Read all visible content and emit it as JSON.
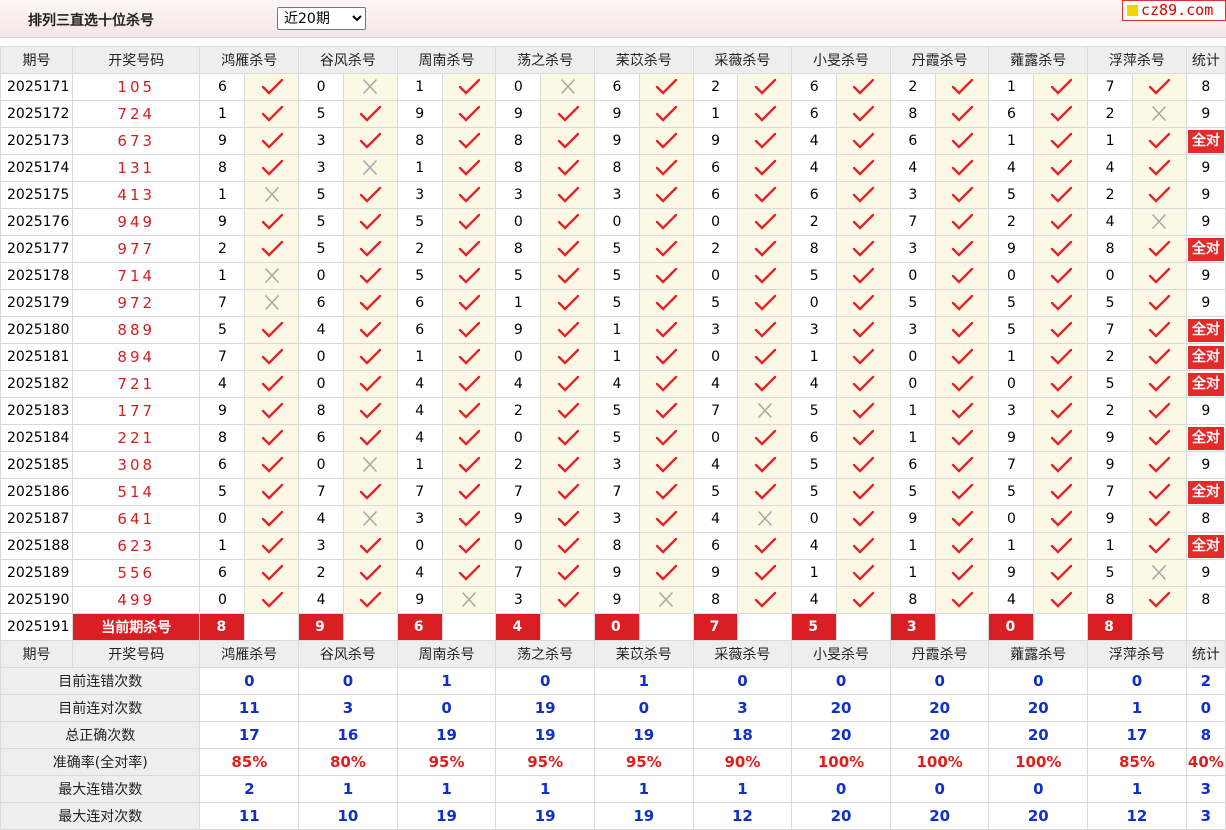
{
  "header": {
    "title": "排列三直选十位杀号",
    "period_select": "近20期"
  },
  "logo": {
    "text": "cz89.com"
  },
  "columns": {
    "issue": "期号",
    "draw": "开奖号码",
    "experts": [
      "鸿雁杀号",
      "谷风杀号",
      "周南杀号",
      "荡之杀号",
      "苿苡杀号",
      "采薇杀号",
      "小旻杀号",
      "丹霞杀号",
      "蕹露杀号",
      "浮萍杀号"
    ],
    "total": "统计"
  },
  "rows": [
    {
      "issue": "2025171",
      "draw": "105",
      "kills": [
        [
          6,
          1
        ],
        [
          0,
          0
        ],
        [
          1,
          1
        ],
        [
          0,
          0
        ],
        [
          6,
          1
        ],
        [
          2,
          1
        ],
        [
          6,
          1
        ],
        [
          2,
          1
        ],
        [
          1,
          1
        ],
        [
          7,
          1
        ]
      ],
      "total": "8"
    },
    {
      "issue": "2025172",
      "draw": "724",
      "kills": [
        [
          1,
          1
        ],
        [
          5,
          1
        ],
        [
          9,
          1
        ],
        [
          9,
          1
        ],
        [
          9,
          1
        ],
        [
          1,
          1
        ],
        [
          6,
          1
        ],
        [
          8,
          1
        ],
        [
          6,
          1
        ],
        [
          2,
          0
        ]
      ],
      "total": "9"
    },
    {
      "issue": "2025173",
      "draw": "673",
      "kills": [
        [
          9,
          1
        ],
        [
          3,
          1
        ],
        [
          8,
          1
        ],
        [
          8,
          1
        ],
        [
          9,
          1
        ],
        [
          9,
          1
        ],
        [
          4,
          1
        ],
        [
          6,
          1
        ],
        [
          1,
          1
        ],
        [
          1,
          1
        ]
      ],
      "total": "全对"
    },
    {
      "issue": "2025174",
      "draw": "131",
      "kills": [
        [
          8,
          1
        ],
        [
          3,
          0
        ],
        [
          1,
          1
        ],
        [
          8,
          1
        ],
        [
          8,
          1
        ],
        [
          6,
          1
        ],
        [
          4,
          1
        ],
        [
          4,
          1
        ],
        [
          4,
          1
        ],
        [
          4,
          1
        ]
      ],
      "total": "9"
    },
    {
      "issue": "2025175",
      "draw": "413",
      "kills": [
        [
          1,
          0
        ],
        [
          5,
          1
        ],
        [
          3,
          1
        ],
        [
          3,
          1
        ],
        [
          3,
          1
        ],
        [
          6,
          1
        ],
        [
          6,
          1
        ],
        [
          3,
          1
        ],
        [
          5,
          1
        ],
        [
          2,
          1
        ]
      ],
      "total": "9"
    },
    {
      "issue": "2025176",
      "draw": "949",
      "kills": [
        [
          9,
          1
        ],
        [
          5,
          1
        ],
        [
          5,
          1
        ],
        [
          0,
          1
        ],
        [
          0,
          1
        ],
        [
          0,
          1
        ],
        [
          2,
          1
        ],
        [
          7,
          1
        ],
        [
          2,
          1
        ],
        [
          4,
          0
        ]
      ],
      "total": "9"
    },
    {
      "issue": "2025177",
      "draw": "977",
      "kills": [
        [
          2,
          1
        ],
        [
          5,
          1
        ],
        [
          2,
          1
        ],
        [
          8,
          1
        ],
        [
          5,
          1
        ],
        [
          2,
          1
        ],
        [
          8,
          1
        ],
        [
          3,
          1
        ],
        [
          9,
          1
        ],
        [
          8,
          1
        ]
      ],
      "total": "全对"
    },
    {
      "issue": "2025178",
      "draw": "714",
      "kills": [
        [
          1,
          0
        ],
        [
          0,
          1
        ],
        [
          5,
          1
        ],
        [
          5,
          1
        ],
        [
          5,
          1
        ],
        [
          0,
          1
        ],
        [
          5,
          1
        ],
        [
          0,
          1
        ],
        [
          0,
          1
        ],
        [
          0,
          1
        ]
      ],
      "total": "9"
    },
    {
      "issue": "2025179",
      "draw": "972",
      "kills": [
        [
          7,
          0
        ],
        [
          6,
          1
        ],
        [
          6,
          1
        ],
        [
          1,
          1
        ],
        [
          5,
          1
        ],
        [
          5,
          1
        ],
        [
          0,
          1
        ],
        [
          5,
          1
        ],
        [
          5,
          1
        ],
        [
          5,
          1
        ]
      ],
      "total": "9"
    },
    {
      "issue": "2025180",
      "draw": "889",
      "kills": [
        [
          5,
          1
        ],
        [
          4,
          1
        ],
        [
          6,
          1
        ],
        [
          9,
          1
        ],
        [
          1,
          1
        ],
        [
          3,
          1
        ],
        [
          3,
          1
        ],
        [
          3,
          1
        ],
        [
          5,
          1
        ],
        [
          7,
          1
        ]
      ],
      "total": "全对"
    },
    {
      "issue": "2025181",
      "draw": "894",
      "kills": [
        [
          7,
          1
        ],
        [
          0,
          1
        ],
        [
          1,
          1
        ],
        [
          0,
          1
        ],
        [
          1,
          1
        ],
        [
          0,
          1
        ],
        [
          1,
          1
        ],
        [
          0,
          1
        ],
        [
          1,
          1
        ],
        [
          2,
          1
        ]
      ],
      "total": "全对"
    },
    {
      "issue": "2025182",
      "draw": "721",
      "kills": [
        [
          4,
          1
        ],
        [
          0,
          1
        ],
        [
          4,
          1
        ],
        [
          4,
          1
        ],
        [
          4,
          1
        ],
        [
          4,
          1
        ],
        [
          4,
          1
        ],
        [
          0,
          1
        ],
        [
          0,
          1
        ],
        [
          5,
          1
        ]
      ],
      "total": "全对"
    },
    {
      "issue": "2025183",
      "draw": "177",
      "kills": [
        [
          9,
          1
        ],
        [
          8,
          1
        ],
        [
          4,
          1
        ],
        [
          2,
          1
        ],
        [
          5,
          1
        ],
        [
          7,
          0
        ],
        [
          5,
          1
        ],
        [
          1,
          1
        ],
        [
          3,
          1
        ],
        [
          2,
          1
        ]
      ],
      "total": "9"
    },
    {
      "issue": "2025184",
      "draw": "221",
      "kills": [
        [
          8,
          1
        ],
        [
          6,
          1
        ],
        [
          4,
          1
        ],
        [
          0,
          1
        ],
        [
          5,
          1
        ],
        [
          0,
          1
        ],
        [
          6,
          1
        ],
        [
          1,
          1
        ],
        [
          9,
          1
        ],
        [
          9,
          1
        ]
      ],
      "total": "全对"
    },
    {
      "issue": "2025185",
      "draw": "308",
      "kills": [
        [
          6,
          1
        ],
        [
          0,
          0
        ],
        [
          1,
          1
        ],
        [
          2,
          1
        ],
        [
          3,
          1
        ],
        [
          4,
          1
        ],
        [
          5,
          1
        ],
        [
          6,
          1
        ],
        [
          7,
          1
        ],
        [
          9,
          1
        ]
      ],
      "total": "9"
    },
    {
      "issue": "2025186",
      "draw": "514",
      "kills": [
        [
          5,
          1
        ],
        [
          7,
          1
        ],
        [
          7,
          1
        ],
        [
          7,
          1
        ],
        [
          7,
          1
        ],
        [
          5,
          1
        ],
        [
          5,
          1
        ],
        [
          5,
          1
        ],
        [
          5,
          1
        ],
        [
          7,
          1
        ]
      ],
      "total": "全对"
    },
    {
      "issue": "2025187",
      "draw": "641",
      "kills": [
        [
          0,
          1
        ],
        [
          4,
          0
        ],
        [
          3,
          1
        ],
        [
          9,
          1
        ],
        [
          3,
          1
        ],
        [
          4,
          0
        ],
        [
          0,
          1
        ],
        [
          9,
          1
        ],
        [
          0,
          1
        ],
        [
          9,
          1
        ]
      ],
      "total": "8"
    },
    {
      "issue": "2025188",
      "draw": "623",
      "kills": [
        [
          1,
          1
        ],
        [
          3,
          1
        ],
        [
          0,
          1
        ],
        [
          0,
          1
        ],
        [
          8,
          1
        ],
        [
          6,
          1
        ],
        [
          4,
          1
        ],
        [
          1,
          1
        ],
        [
          1,
          1
        ],
        [
          1,
          1
        ]
      ],
      "total": "全对"
    },
    {
      "issue": "2025189",
      "draw": "556",
      "kills": [
        [
          6,
          1
        ],
        [
          2,
          1
        ],
        [
          4,
          1
        ],
        [
          7,
          1
        ],
        [
          9,
          1
        ],
        [
          9,
          1
        ],
        [
          1,
          1
        ],
        [
          1,
          1
        ],
        [
          9,
          1
        ],
        [
          5,
          0
        ]
      ],
      "total": "9"
    },
    {
      "issue": "2025190",
      "draw": "499",
      "kills": [
        [
          0,
          1
        ],
        [
          4,
          1
        ],
        [
          9,
          0
        ],
        [
          3,
          1
        ],
        [
          9,
          0
        ],
        [
          8,
          1
        ],
        [
          4,
          1
        ],
        [
          8,
          1
        ],
        [
          4,
          1
        ],
        [
          8,
          1
        ]
      ],
      "total": "8"
    }
  ],
  "current": {
    "issue": "2025191",
    "label": "当前期杀号",
    "kills": [
      "8",
      "9",
      "6",
      "4",
      "0",
      "7",
      "5",
      "3",
      "0",
      "8"
    ]
  },
  "summary": [
    {
      "label": "目前连错次数",
      "values": [
        "0",
        "0",
        "1",
        "0",
        "1",
        "0",
        "0",
        "0",
        "0",
        "0"
      ],
      "total": "2",
      "style": "blue"
    },
    {
      "label": "目前连对次数",
      "values": [
        "11",
        "3",
        "0",
        "19",
        "0",
        "3",
        "20",
        "20",
        "20",
        "1"
      ],
      "total": "0",
      "style": "blue"
    },
    {
      "label": "总正确次数",
      "values": [
        "17",
        "16",
        "19",
        "19",
        "19",
        "18",
        "20",
        "20",
        "20",
        "17"
      ],
      "total": "8",
      "style": "blue"
    },
    {
      "label": "准确率(全对率)",
      "values": [
        "85%",
        "80%",
        "95%",
        "95%",
        "95%",
        "90%",
        "100%",
        "100%",
        "100%",
        "85%"
      ],
      "total": "40%",
      "style": "red"
    },
    {
      "label": "最大连错次数",
      "values": [
        "2",
        "1",
        "1",
        "1",
        "1",
        "1",
        "0",
        "0",
        "0",
        "1"
      ],
      "total": "3",
      "style": "blue"
    },
    {
      "label": "最大连对次数",
      "values": [
        "11",
        "10",
        "19",
        "19",
        "19",
        "12",
        "20",
        "20",
        "20",
        "12"
      ],
      "total": "3",
      "style": "blue"
    }
  ],
  "icons": {
    "correct": "check-icon",
    "wrong": "cross-icon"
  },
  "colors": {
    "check": "#e0262b",
    "cross": "#a9a9a9",
    "badge": "#e52a2a",
    "summary_value": "#1030c8",
    "rate_value": "#e01e1e"
  }
}
